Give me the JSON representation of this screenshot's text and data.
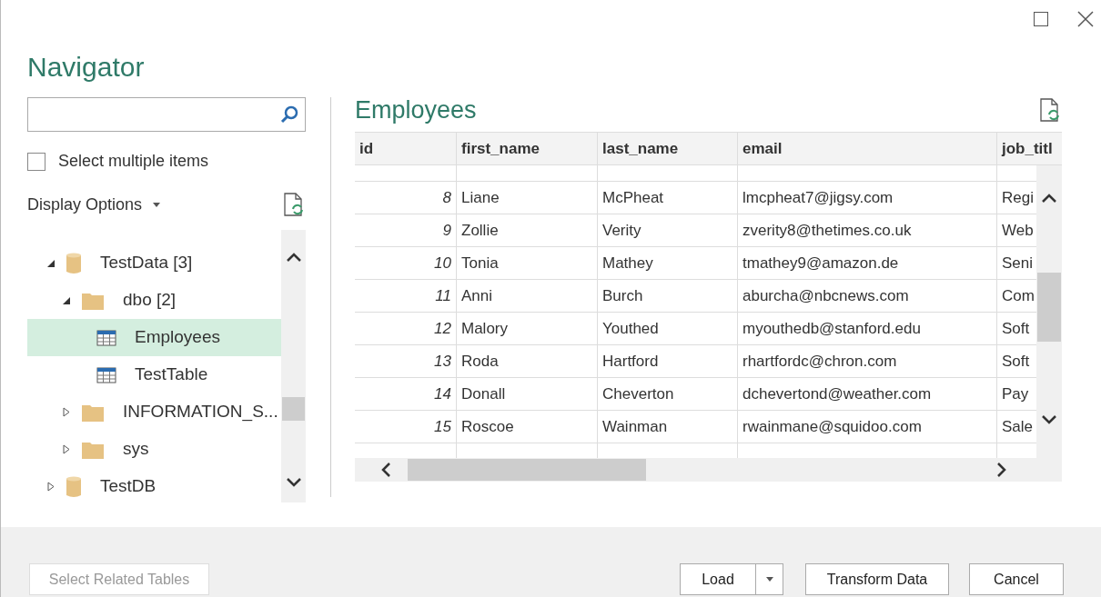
{
  "window": {
    "title": "Navigator"
  },
  "select_multiple": {
    "label": "Select multiple items",
    "checked": false
  },
  "display_options": {
    "label": "Display Options"
  },
  "tree": [
    {
      "label": "TestData [3]",
      "kind": "database",
      "expanded": true,
      "children": [
        {
          "label": "dbo [2]",
          "kind": "folder",
          "expanded": true,
          "children": [
            {
              "label": "Employees",
              "kind": "table",
              "selected": true
            },
            {
              "label": "TestTable",
              "kind": "table",
              "selected": false
            }
          ]
        },
        {
          "label": "INFORMATION_S...",
          "kind": "folder",
          "expanded": false
        },
        {
          "label": "sys",
          "kind": "folder",
          "expanded": false
        }
      ]
    },
    {
      "label": "TestDB",
      "kind": "database",
      "expanded": false
    }
  ],
  "preview": {
    "title": "Employees",
    "columns": [
      "id",
      "first_name",
      "last_name",
      "email",
      "job_titl"
    ],
    "rows": [
      [
        "8",
        "Liane",
        "McPheat",
        "lmcpheat7@jigsy.com",
        "Regi"
      ],
      [
        "9",
        "Zollie",
        "Verity",
        "zverity8@thetimes.co.uk",
        "Web"
      ],
      [
        "10",
        "Tonia",
        "Mathey",
        "tmathey9@amazon.de",
        "Seni"
      ],
      [
        "11",
        "Anni",
        "Burch",
        "aburcha@nbcnews.com",
        "Com"
      ],
      [
        "12",
        "Malory",
        "Youthed",
        "myouthedb@stanford.edu",
        "Soft"
      ],
      [
        "13",
        "Roda",
        "Hartford",
        "rhartfordc@chron.com",
        "Soft"
      ],
      [
        "14",
        "Donall",
        "Cheverton",
        "dchevertond@weather.com",
        "Pay"
      ],
      [
        "15",
        "Roscoe",
        "Wainman",
        "rwainmane@squidoo.com",
        "Sale"
      ]
    ]
  },
  "buttons": [
    {
      "label": "Select Related Tables",
      "kind": "plain",
      "disabled": true
    },
    {
      "label": "Load",
      "kind": "split",
      "disabled": false
    },
    {
      "label": "Transform Data",
      "kind": "plain",
      "disabled": false
    },
    {
      "label": "Cancel",
      "kind": "plain",
      "disabled": false
    }
  ]
}
